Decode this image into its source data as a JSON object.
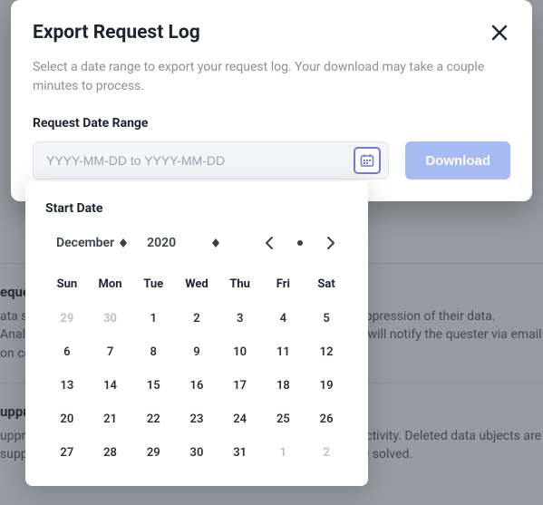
{
  "modal": {
    "title": "Export Request Log",
    "description": "Select a date range to export your request log. Your download may take a couple minutes to process.",
    "field_label": "Request Date Range",
    "input_placeholder": "YYYY-MM-DD to YYYY-MM-DD",
    "download_label": "Download"
  },
  "datepicker": {
    "title": "Start Date",
    "month": "December",
    "year": "2020",
    "weekdays": [
      "Sun",
      "Mon",
      "Tue",
      "Wed",
      "Thu",
      "Fri",
      "Sat"
    ],
    "weeks": [
      [
        {
          "d": "29",
          "muted": true
        },
        {
          "d": "30",
          "muted": true
        },
        {
          "d": "1"
        },
        {
          "d": "2"
        },
        {
          "d": "3"
        },
        {
          "d": "4"
        },
        {
          "d": "5"
        }
      ],
      [
        {
          "d": "6"
        },
        {
          "d": "7"
        },
        {
          "d": "8"
        },
        {
          "d": "9"
        },
        {
          "d": "10"
        },
        {
          "d": "11"
        },
        {
          "d": "12"
        }
      ],
      [
        {
          "d": "13"
        },
        {
          "d": "14"
        },
        {
          "d": "15"
        },
        {
          "d": "16"
        },
        {
          "d": "17"
        },
        {
          "d": "18"
        },
        {
          "d": "19"
        }
      ],
      [
        {
          "d": "20"
        },
        {
          "d": "21"
        },
        {
          "d": "22"
        },
        {
          "d": "23"
        },
        {
          "d": "24"
        },
        {
          "d": "25"
        },
        {
          "d": "26"
        }
      ],
      [
        {
          "d": "27"
        },
        {
          "d": "28"
        },
        {
          "d": "29"
        },
        {
          "d": "30"
        },
        {
          "d": "31"
        },
        {
          "d": "1",
          "muted": true
        },
        {
          "d": "2",
          "muted": true
        }
      ]
    ]
  },
  "background": {
    "sections": [
      {
        "heading": "equests",
        "body": "ata subjects may request access to their data or the deletion / suppression of their data. Analytics end users must be contacted to fulfill each request. We will notify the quester via email on completion."
      },
      {
        "heading": "uppression",
        "body": "uppressed data subjects are excluded from storage and certain activity. Deleted data ubjects are suppressed by default so that new data on that identity will not be solved."
      }
    ]
  }
}
